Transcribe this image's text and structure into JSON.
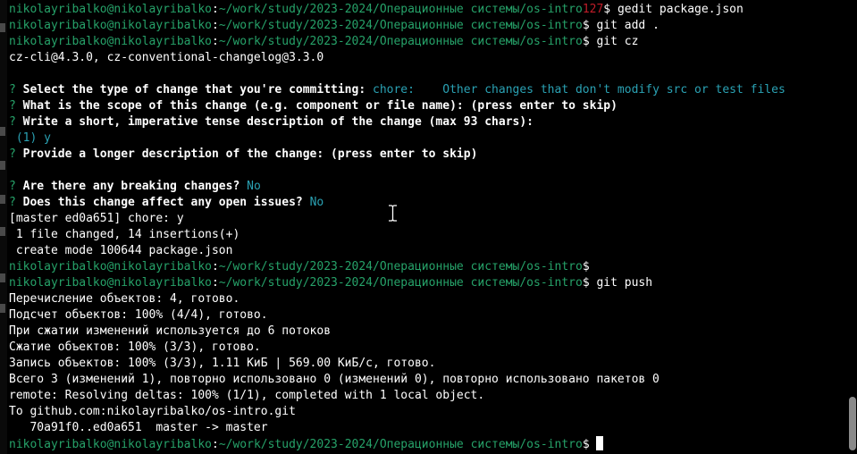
{
  "terminal": {
    "user_host": "nikolayribalko@nikolayribalko",
    "path": "~/work/study/2023-2024/Операционные системы/os-intro",
    "lines": [
      {
        "prompt": true,
        "exit_code": "127",
        "cmd": "gedit package.json"
      },
      {
        "prompt": true,
        "cmd": "git add ."
      },
      {
        "prompt": true,
        "cmd": "git cz"
      },
      {
        "text": "cz-cli@4.3.0, cz-conventional-changelog@3.3.0"
      },
      {
        "text": ""
      },
      {
        "q": "Select the type of change that you're committing:",
        "answer": "chore:    Other changes that don't modify src or test files"
      },
      {
        "q": "What is the scope of this change (e.g. component or file name): (press enter to skip)"
      },
      {
        "q": "Write a short, imperative tense description of the change (max 93 chars):"
      },
      {
        "indent_answer": "(1) y"
      },
      {
        "q": "Provide a longer description of the change: (press enter to skip)"
      },
      {
        "text": ""
      },
      {
        "q": "Are there any breaking changes?",
        "answer": "No"
      },
      {
        "q": "Does this change affect any open issues?",
        "answer": "No"
      },
      {
        "text": "[master ed0a651] chore: y"
      },
      {
        "text": " 1 file changed, 14 insertions(+)"
      },
      {
        "text": " create mode 100644 package.json"
      },
      {
        "prompt": true,
        "cmd": ""
      },
      {
        "prompt": true,
        "cmd": "git push"
      },
      {
        "text": "Перечисление объектов: 4, готово."
      },
      {
        "text": "Подсчет объектов: 100% (4/4), готово."
      },
      {
        "text": "При сжатии изменений используется до 6 потоков"
      },
      {
        "text": "Сжатие объектов: 100% (3/3), готово."
      },
      {
        "text": "Запись объектов: 100% (3/3), 1.11 КиБ | 569.00 КиБ/с, готово."
      },
      {
        "text": "Всего 3 (изменений 1), повторно использовано 0 (изменений 0), повторно использовано пакетов 0"
      },
      {
        "text": "remote: Resolving deltas: 100% (1/1), completed with 1 local object."
      },
      {
        "text": "To github.com:nikolayribalko/os-intro.git"
      },
      {
        "text": "   70a91f0..ed0a651  master -> master"
      },
      {
        "prompt": true,
        "cmd": "",
        "cursor": true
      }
    ]
  },
  "colors": {
    "background": "#000000",
    "prompt_green": "#26a269",
    "answer_cyan": "#2aa1b3",
    "error_red": "#c01c28"
  }
}
